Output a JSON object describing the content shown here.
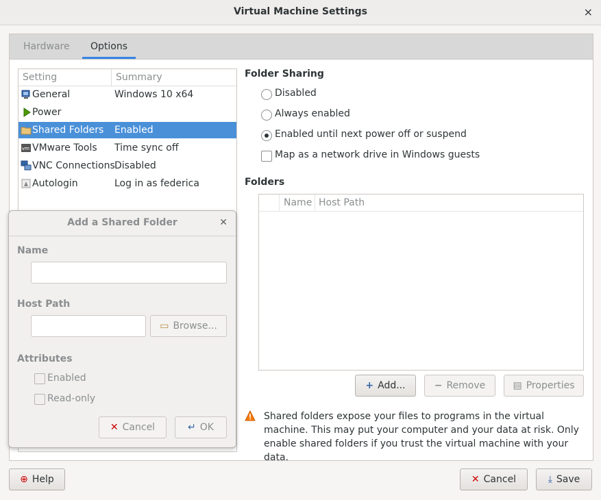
{
  "window": {
    "title": "Virtual Machine Settings",
    "close_glyph": "×"
  },
  "tabs": [
    {
      "label": "Hardware",
      "active": false
    },
    {
      "label": "Options",
      "active": true
    }
  ],
  "settings_list": {
    "headers": [
      "Setting",
      "Summary"
    ],
    "rows": [
      {
        "icon": "general-icon",
        "setting": "General",
        "summary": "Windows 10 x64",
        "selected": false
      },
      {
        "icon": "power-icon",
        "setting": "Power",
        "summary": "",
        "selected": false
      },
      {
        "icon": "folder-icon",
        "setting": "Shared Folders",
        "summary": "Enabled",
        "selected": true
      },
      {
        "icon": "vmware-tools-icon",
        "setting": "VMware Tools",
        "summary": "Time sync off",
        "selected": false
      },
      {
        "icon": "vnc-icon",
        "setting": "VNC Connections",
        "summary": "Disabled",
        "selected": false
      },
      {
        "icon": "autologin-icon",
        "setting": "Autologin",
        "summary": "Log in as federica",
        "selected": false
      }
    ]
  },
  "folder_sharing": {
    "title": "Folder Sharing",
    "options": [
      {
        "label": "Disabled",
        "checked": false
      },
      {
        "label": "Always enabled",
        "checked": false
      },
      {
        "label": "Enabled until next power off or suspend",
        "checked": true
      }
    ],
    "map_drive": {
      "label": "Map as a network drive in Windows guests",
      "checked": false
    }
  },
  "folders": {
    "title": "Folders",
    "columns": [
      "Name",
      "Host Path"
    ],
    "buttons": {
      "add": "Add...",
      "remove": "Remove",
      "properties": "Properties"
    }
  },
  "warning": {
    "text": "Shared folders expose your files to programs in the virtual machine. This may put your computer and your data at risk. Only enable shared folders if you trust the virtual machine with your data.",
    "color": "#f57900"
  },
  "dialog": {
    "title": "Add a Shared Folder",
    "name_label": "Name",
    "name_value": "",
    "host_path_label": "Host Path",
    "host_path_value": "",
    "browse": "Browse...",
    "attributes_label": "Attributes",
    "enabled": {
      "label": "Enabled",
      "checked": false
    },
    "read_only": {
      "label": "Read-only",
      "checked": false
    },
    "cancel": "Cancel",
    "ok": "OK"
  },
  "footer": {
    "help": "Help",
    "cancel": "Cancel",
    "save": "Save"
  },
  "colors": {
    "selection": "#4a90d9",
    "accent": "#3584e4",
    "danger": "#cc0000"
  }
}
